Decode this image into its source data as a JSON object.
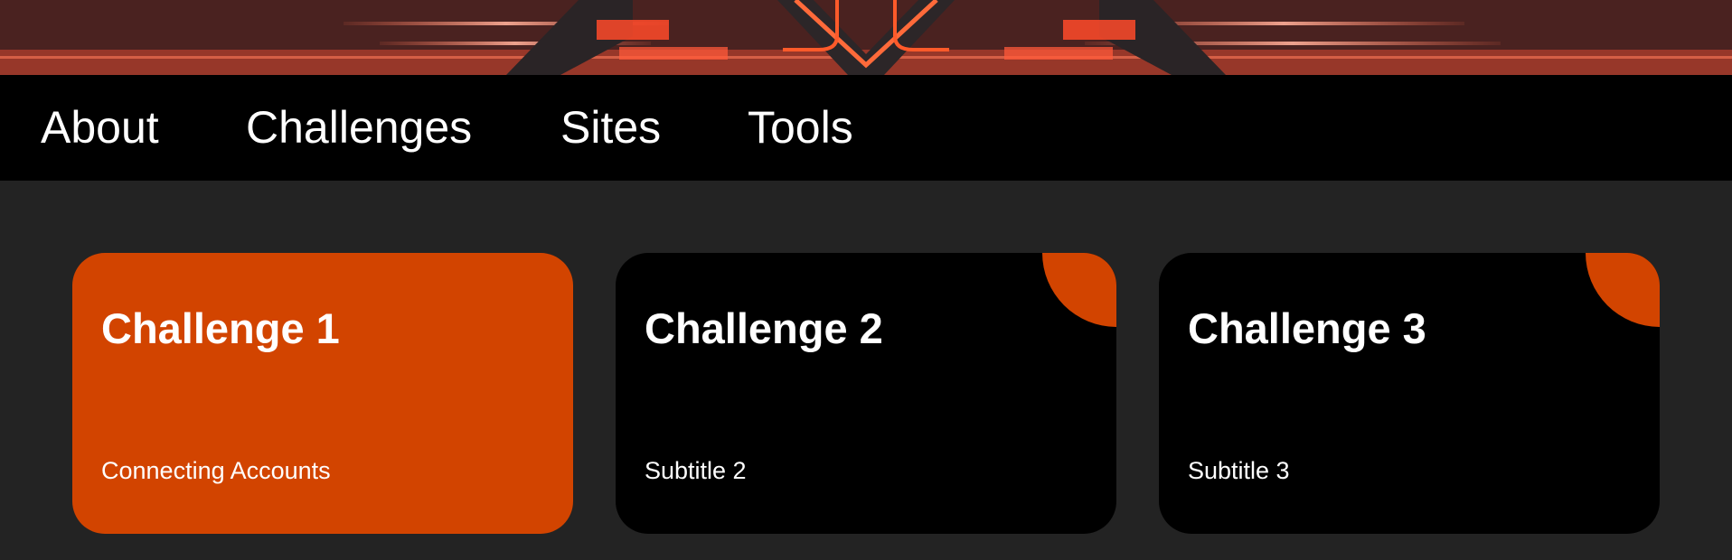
{
  "colors": {
    "accent": "#d24400",
    "nav_background": "#000000",
    "page_background": "#232323",
    "card_background": "#000000",
    "text": "#ffffff"
  },
  "nav": {
    "items": [
      {
        "label": "About"
      },
      {
        "label": "Challenges"
      },
      {
        "label": "Sites"
      },
      {
        "label": "Tools"
      }
    ]
  },
  "cards": [
    {
      "title": "Challenge 1",
      "subtitle": "Connecting Accounts",
      "active": true
    },
    {
      "title": "Challenge 2",
      "subtitle": "Subtitle 2",
      "active": false
    },
    {
      "title": "Challenge 3",
      "subtitle": "Subtitle 3",
      "active": false
    }
  ]
}
